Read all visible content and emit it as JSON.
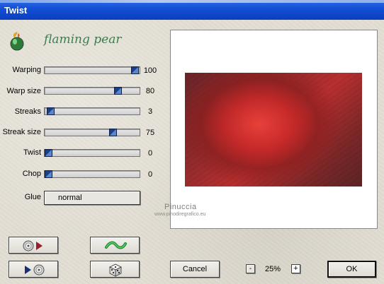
{
  "window": {
    "title": "Twist"
  },
  "brand": {
    "name": "flaming pear"
  },
  "sliders": [
    {
      "label": "Warping",
      "value": "100",
      "fraction": 1.0
    },
    {
      "label": "Warp size",
      "value": "80",
      "fraction": 0.8
    },
    {
      "label": "Streaks",
      "value": "3",
      "fraction": 0.03
    },
    {
      "label": "Streak size",
      "value": "75",
      "fraction": 0.75
    },
    {
      "label": "Twist",
      "value": "0",
      "fraction": 0.0
    },
    {
      "label": "Chop",
      "value": "0",
      "fraction": 0.0
    }
  ],
  "glue": {
    "label": "Glue",
    "value": "normal"
  },
  "preview": {
    "watermark": "Pinuccia",
    "watermark_url": "www.pinodiregrafico.eu"
  },
  "buttons": {
    "cancel": "Cancel",
    "ok": "OK",
    "zoom_minus": "-",
    "zoom_plus": "+"
  },
  "zoom": {
    "value": "25%"
  },
  "icons": {
    "load_preset": "disc-play-icon",
    "save_preset": "play-disc-icon",
    "random": "wave-icon",
    "dice": "dice-icon"
  }
}
